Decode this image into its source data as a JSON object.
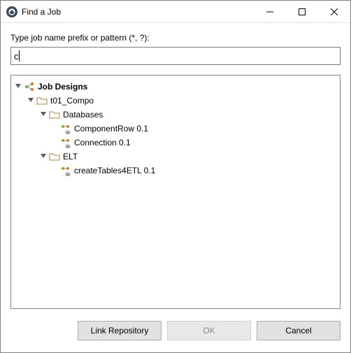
{
  "window": {
    "title": "Find a Job"
  },
  "form": {
    "prompt": "Type job name prefix or pattern (*, ?):",
    "value": "c"
  },
  "tree": {
    "root": {
      "label": "Job Designs"
    },
    "n1": {
      "label": "t01_Compo"
    },
    "n2": {
      "label": "Databases"
    },
    "n3": {
      "label": "ComponentRow 0.1"
    },
    "n4": {
      "label": "Connection 0.1"
    },
    "n5": {
      "label": "ELT"
    },
    "n6": {
      "label": "createTables4ETL 0.1"
    }
  },
  "buttons": {
    "link": "Link Repository",
    "ok": "OK",
    "cancel": "Cancel"
  }
}
